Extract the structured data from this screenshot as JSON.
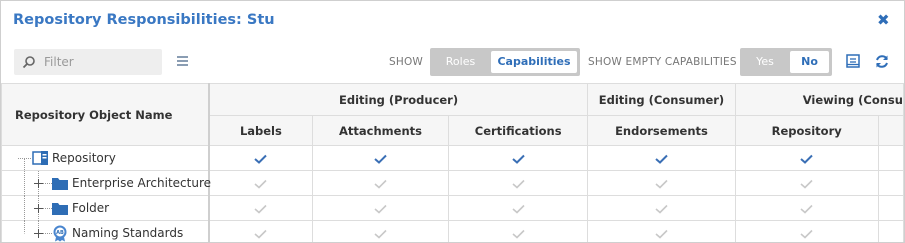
{
  "dialog": {
    "title": "Repository Responsibilities: Stu"
  },
  "toolbar": {
    "filter_placeholder": "Filter",
    "show_label": "SHOW",
    "show_options": [
      "Roles",
      "Capabilities"
    ],
    "show_selected": "Capabilities",
    "show_empty_label": "SHOW EMPTY CAPABILITIES",
    "empty_options": [
      "Yes",
      "No"
    ],
    "empty_selected": "No"
  },
  "grid": {
    "name_header": "Repository Object Name",
    "groups": [
      "Editing (Producer)",
      "Editing (Consumer)",
      "Viewing (Consu"
    ],
    "columns": [
      "Labels",
      "Attachments",
      "Certifications",
      "Endorsements",
      "Repository"
    ],
    "rows": [
      {
        "name": "Repository",
        "icon": "repository-icon",
        "checks": [
          true,
          true,
          true,
          true,
          true
        ]
      },
      {
        "name": "Enterprise Architecture",
        "icon": "folder-icon",
        "checks": [
          false,
          false,
          false,
          false,
          false
        ]
      },
      {
        "name": "Folder",
        "icon": "folder-icon",
        "checks": [
          false,
          false,
          false,
          false,
          false
        ]
      },
      {
        "name": "Naming Standards",
        "icon": "naming-standards-icon",
        "checks": [
          false,
          false,
          false,
          false,
          false
        ]
      }
    ]
  },
  "colors": {
    "accent": "#2f6eb8",
    "title": "#3a78c3",
    "check_active": "#3a6fb5",
    "check_inactive": "#c8c8c8",
    "folder": "#2e6db5"
  }
}
